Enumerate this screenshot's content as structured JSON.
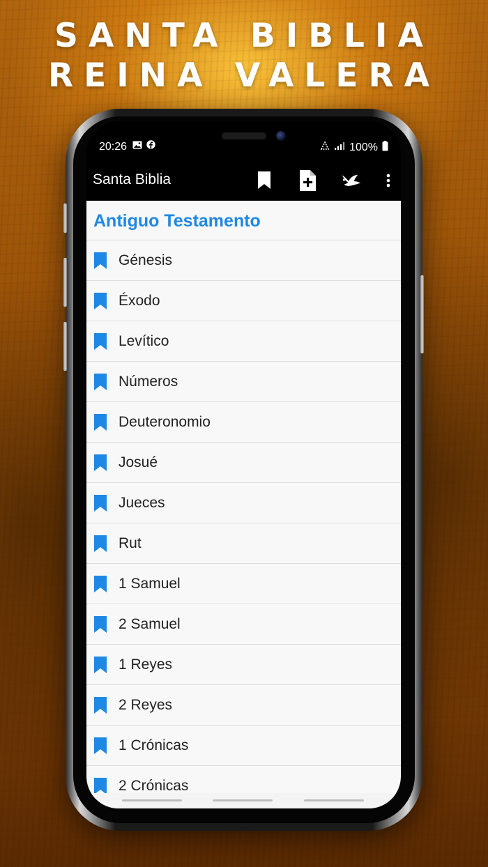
{
  "headline": {
    "line1": "SANTA BIBLIA",
    "line2": "REINA VALERA"
  },
  "status_bar": {
    "time": "20:26",
    "battery": "100%"
  },
  "app_bar": {
    "title": "Santa Biblia"
  },
  "section": {
    "title": "Antiguo Testamento"
  },
  "books": [
    {
      "label": "Génesis"
    },
    {
      "label": "Éxodo"
    },
    {
      "label": "Levítico"
    },
    {
      "label": "Números"
    },
    {
      "label": "Deuteronomio"
    },
    {
      "label": "Josué"
    },
    {
      "label": "Jueces"
    },
    {
      "label": "Rut"
    },
    {
      "label": "1 Samuel"
    },
    {
      "label": "2 Samuel"
    },
    {
      "label": "1 Reyes"
    },
    {
      "label": "2 Reyes"
    },
    {
      "label": "1 Crónicas"
    },
    {
      "label": "2 Crónicas"
    }
  ],
  "colors": {
    "accent": "#1e88e5",
    "app_bar": "#000000",
    "list_background": "#f8f8f8",
    "divider": "#dddddd"
  },
  "icons": {
    "app_bar": [
      "bookmark-icon",
      "add-note-icon",
      "dove-icon",
      "more-vert-icon"
    ],
    "list_item": "bookmark-icon"
  }
}
